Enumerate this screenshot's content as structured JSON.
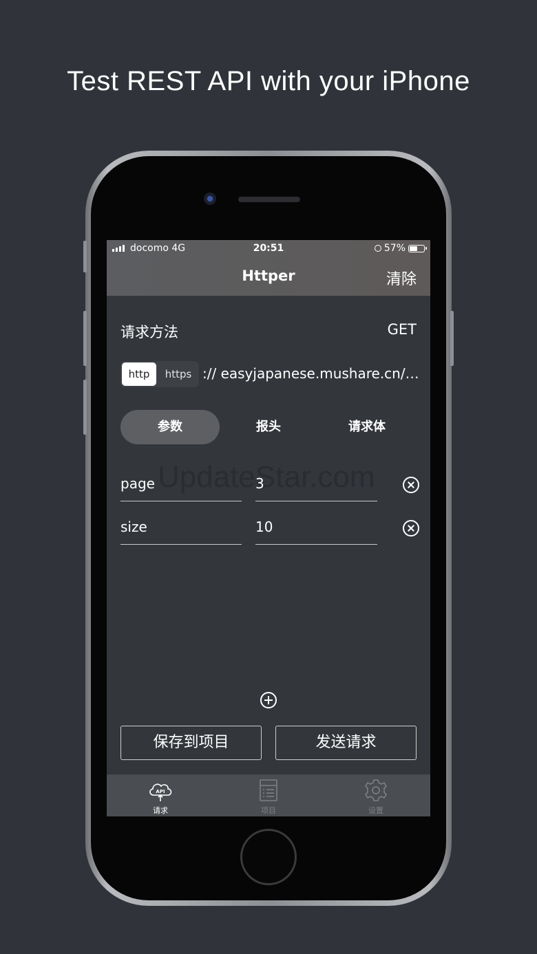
{
  "headline": "Test REST API with your iPhone",
  "status_bar": {
    "carrier": "docomo  4G",
    "time": "20:51",
    "battery": "57%",
    "battery_level": 0.57
  },
  "nav": {
    "title": "Httper",
    "clear_label": "清除"
  },
  "request": {
    "method_label": "请求方法",
    "method_value": "GET",
    "protocol_options": [
      "http",
      "https"
    ],
    "selected_protocol": "http",
    "url": ":// easyjapanese.mushare.cn/a..."
  },
  "tabs": [
    {
      "label": "参数",
      "active": true
    },
    {
      "label": "报头",
      "active": false
    },
    {
      "label": "请求体",
      "active": false
    }
  ],
  "params": [
    {
      "key": "page",
      "value": "3"
    },
    {
      "key": "size",
      "value": "10"
    }
  ],
  "watermark": "UpdateStar.com",
  "actions": {
    "save_label": "保存到项目",
    "send_label": "发送请求"
  },
  "tabbar": [
    {
      "label": "请求",
      "icon": "api-cloud-icon",
      "active": true
    },
    {
      "label": "项目",
      "icon": "document-list-icon",
      "active": false
    },
    {
      "label": "设置",
      "icon": "gear-icon",
      "active": false
    }
  ],
  "colors": {
    "background": "#30343a",
    "screen": "#33373c",
    "active_tab": "#5d5f62",
    "inactive_tabbar": "#7d8084"
  }
}
